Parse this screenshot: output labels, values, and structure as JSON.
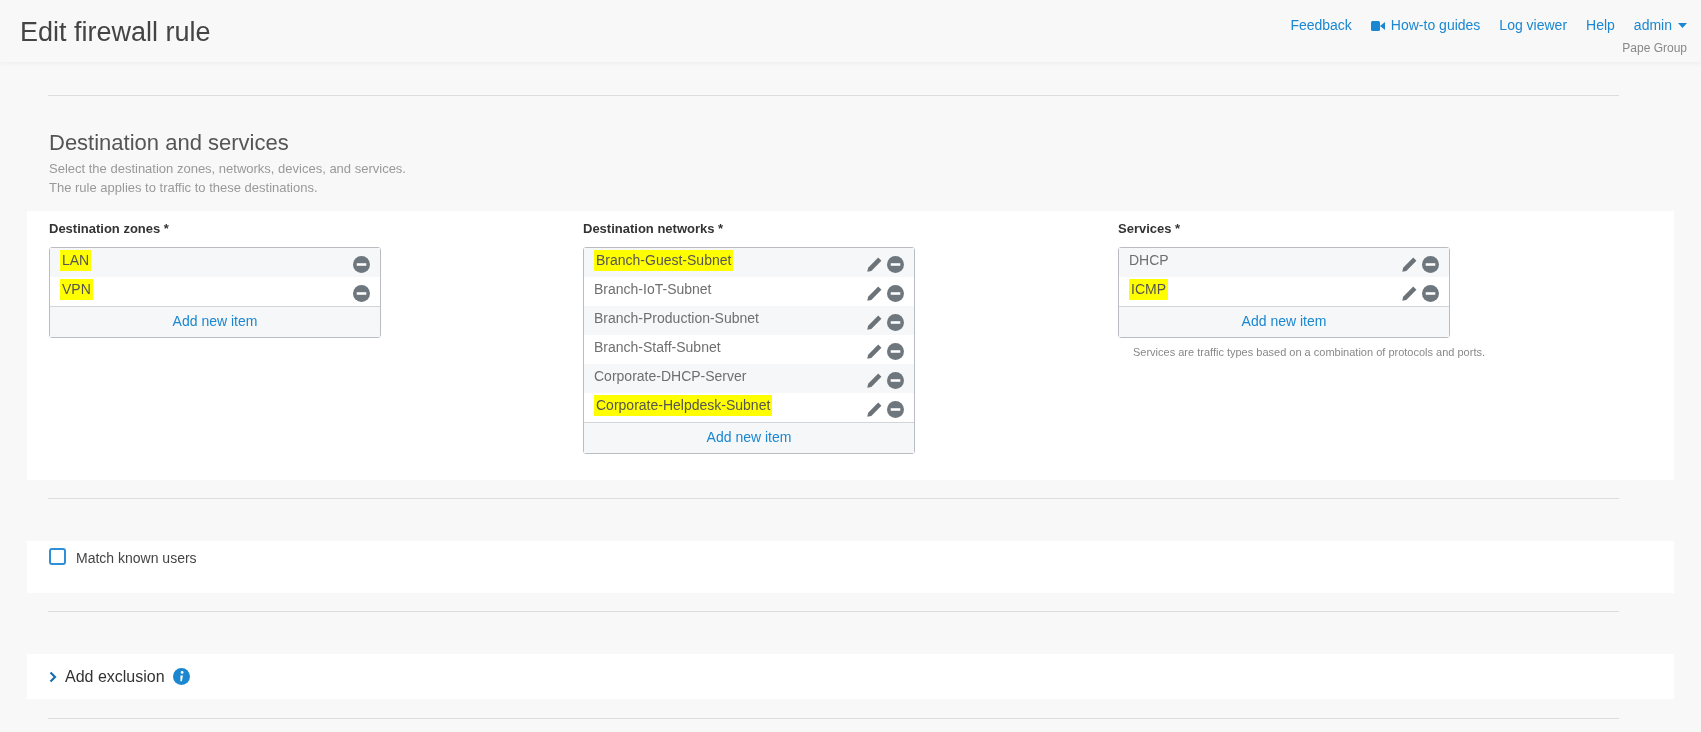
{
  "header": {
    "title": "Edit firewall rule",
    "links": [
      {
        "label": "Feedback",
        "kind": "plain"
      },
      {
        "label": "How-to guides",
        "kind": "video"
      },
      {
        "label": "Log viewer",
        "kind": "plain"
      },
      {
        "label": "Help",
        "kind": "plain"
      },
      {
        "label": "admin",
        "kind": "menu"
      }
    ],
    "organization": "Pape Group"
  },
  "section": {
    "title": "Destination and services",
    "description_lines": [
      "Select the destination zones, networks, devices, and services.",
      "The rule applies to traffic to these destinations."
    ]
  },
  "lists": [
    {
      "label": "Destination zones *",
      "editable": false,
      "items": [
        {
          "name": "LAN",
          "highlighted": true
        },
        {
          "name": "VPN",
          "highlighted": true
        }
      ],
      "add_label": "Add new item"
    },
    {
      "label": "Destination networks *",
      "editable": true,
      "items": [
        {
          "name": "Branch-Guest-Subnet",
          "highlighted": true
        },
        {
          "name": "Branch-IoT-Subnet",
          "highlighted": false
        },
        {
          "name": "Branch-Production-Subnet",
          "highlighted": false
        },
        {
          "name": "Branch-Staff-Subnet",
          "highlighted": false
        },
        {
          "name": "Corporate-DHCP-Server",
          "highlighted": false
        },
        {
          "name": "Corporate-Helpdesk-Subnet",
          "highlighted": true
        }
      ],
      "add_label": "Add new item"
    },
    {
      "label": "Services *",
      "editable": true,
      "items": [
        {
          "name": "DHCP",
          "highlighted": false
        },
        {
          "name": "ICMP",
          "highlighted": true
        }
      ],
      "add_label": "Add new item",
      "note": "Services are traffic types based on a combination of protocols and ports."
    }
  ],
  "match_known_users": {
    "label": "Match known users",
    "checked": false
  },
  "exclusion": {
    "label": "Add exclusion",
    "expanded": false
  }
}
